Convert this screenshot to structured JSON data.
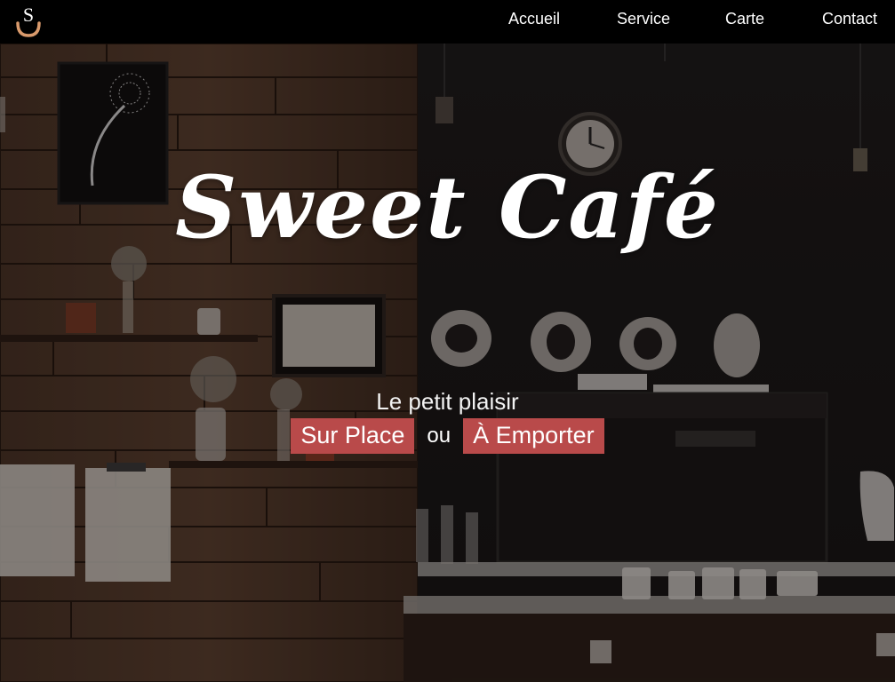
{
  "nav": {
    "logo_letter": "S",
    "items": [
      {
        "label": "Accueil"
      },
      {
        "label": "Service"
      },
      {
        "label": "Carte"
      },
      {
        "label": "Contact"
      }
    ]
  },
  "hero": {
    "title": "Sweet Café",
    "subtitle": "Le petit plaisir",
    "cta_dine_in": "Sur Place",
    "separator": "ou",
    "cta_takeaway": "À Emporter"
  },
  "colors": {
    "nav_background": "#000000",
    "accent": "#b94a4a",
    "logo_accent": "#d99a6c",
    "text": "#ffffff"
  },
  "icons": {
    "logo": "cup-logo-icon"
  }
}
